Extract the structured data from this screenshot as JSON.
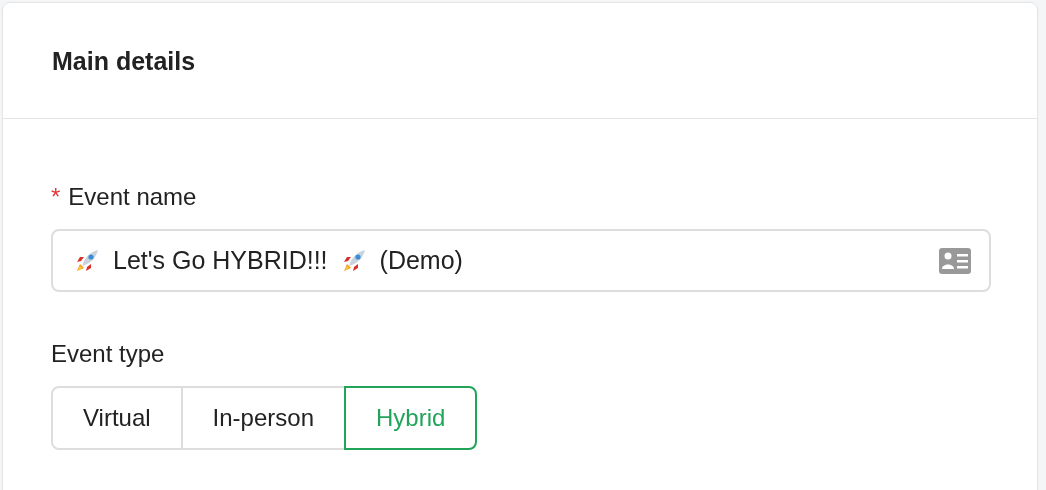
{
  "card": {
    "title": "Main details"
  },
  "event_name": {
    "required_mark": "*",
    "label": "Event name",
    "segments": [
      {
        "kind": "icon"
      },
      {
        "kind": "text",
        "text": "Let's Go HYBRID!!!"
      },
      {
        "kind": "icon"
      },
      {
        "kind": "text",
        "text": "(Demo)"
      }
    ]
  },
  "event_type": {
    "label": "Event type",
    "options": [
      {
        "label": "Virtual",
        "selected": false
      },
      {
        "label": "In-person",
        "selected": false
      },
      {
        "label": "Hybrid",
        "selected": true
      }
    ]
  }
}
